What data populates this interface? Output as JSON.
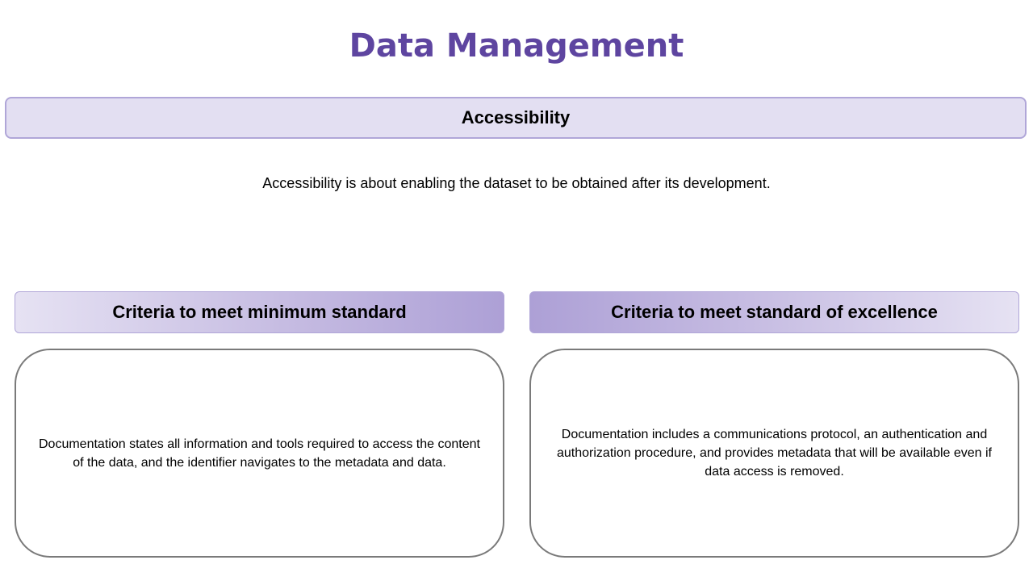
{
  "slide": {
    "title": "Data Management",
    "section_heading": "Accessibility",
    "description": "Accessibility is about enabling the dataset to be obtained after its development.",
    "criteria": [
      {
        "heading": "Criteria to meet minimum standard",
        "body": "Documentation states all information and tools required to access the content of the data, and the identifier navigates to the metadata and data."
      },
      {
        "heading": "Criteria to meet standard of excellence",
        "body": "Documentation includes a communications protocol, an authentication and authorization procedure, and provides metadata that will be available even if data access is removed."
      }
    ]
  },
  "colors": {
    "title": "#5e45a0",
    "section_fill": "#e3dff2",
    "section_border": "#b0a6d8",
    "header_gradient_dark": "#ada0d6",
    "header_gradient_light": "#e6e2f3",
    "box_border": "#7a7a7a"
  }
}
